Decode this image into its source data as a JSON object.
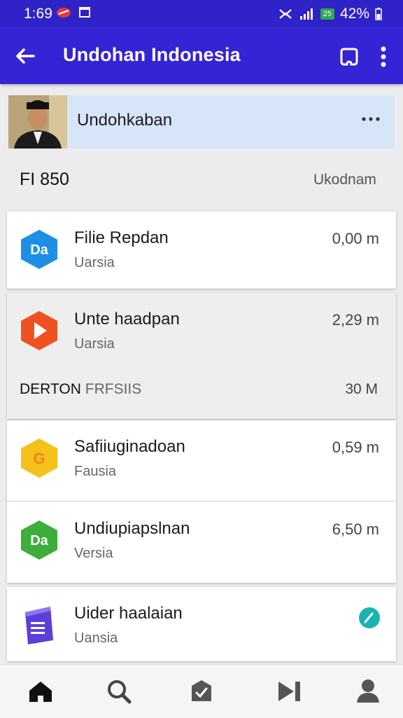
{
  "status_bar": {
    "time": "1:69",
    "network_badge": "25",
    "battery": "42%"
  },
  "app_bar": {
    "title": "Undohan Indonesia",
    "icons": [
      "back-arrow-icon",
      "cast-icon",
      "more-vert-icon"
    ]
  },
  "profile": {
    "name": "Undohkaban"
  },
  "section1": {
    "label": "FI 850",
    "right": "Ukodnam"
  },
  "items": [
    {
      "title": "Filie Repdan",
      "sub": "Uarsia",
      "size": "0,00 m",
      "icon": "da-blue-hexagon-icon"
    },
    {
      "title": "Unte haadpan",
      "sub": "Uarsia",
      "size": "2,29 m",
      "icon": "play-orange-hexagon-icon"
    },
    {
      "title": "Safiiuginadoan",
      "sub": "Fausia",
      "size": "0,59 m",
      "icon": "g-yellow-hexagon-icon"
    },
    {
      "title": "Undiupiapslnan",
      "sub": "Versia",
      "size": "6,50 m",
      "icon": "da-green-hexagon-icon"
    },
    {
      "title": "Uider haalaian",
      "sub": "Uansia",
      "size": "",
      "icon": "document-purple-icon"
    }
  ],
  "section2": {
    "label_bold": "DERTON",
    "label_light": "FRFSIIS",
    "size": "30 M"
  },
  "bottom_nav": [
    "home-icon",
    "search-icon",
    "inbox-check-icon",
    "skip-next-icon",
    "profile-icon"
  ],
  "colors": {
    "status_bar": "#2f22c7",
    "app_bar": "#3424d6",
    "profile_bg": "#d6e6f8",
    "accent_teal": "#1ab3b0"
  }
}
